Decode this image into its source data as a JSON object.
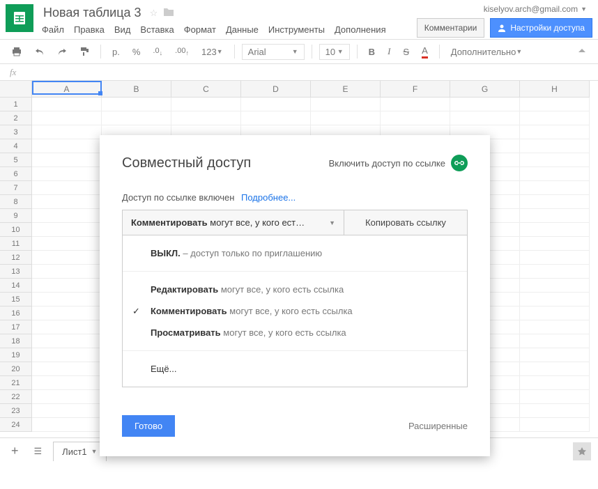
{
  "header": {
    "doc_title": "Новая таблица 3",
    "user_email": "kiselyov.arch@gmail.com",
    "comments_btn": "Комментарии",
    "share_btn": "Настройки доступа"
  },
  "menu": {
    "file": "Файл",
    "edit": "Правка",
    "view": "Вид",
    "insert": "Вставка",
    "format": "Формат",
    "data": "Данные",
    "tools": "Инструменты",
    "addons": "Дополнения"
  },
  "toolbar": {
    "currency": "р.",
    "percent": "%",
    "dec_dec": ".0",
    "dec_inc": ".00",
    "numfmt": "123",
    "font": "Arial",
    "size": "10",
    "bold": "B",
    "italic": "I",
    "strike": "S",
    "textcolor": "A",
    "more": "Дополнительно"
  },
  "fx_label": "fx",
  "columns": [
    "A",
    "B",
    "C",
    "D",
    "E",
    "F",
    "G",
    "H"
  ],
  "rows": [
    1,
    2,
    3,
    4,
    5,
    6,
    7,
    8,
    9,
    10,
    11,
    12,
    13,
    14,
    15,
    16,
    17,
    18,
    19,
    20,
    21,
    22,
    23,
    24
  ],
  "footer": {
    "sheet_tab": "Лист1"
  },
  "share": {
    "title": "Совместный доступ",
    "enable_link_label": "Включить доступ по ссылке",
    "link_status": "Доступ по ссылке включен",
    "learn_more": "Подробнее...",
    "select_bold": "Комментировать",
    "select_rest": " могут все, у кого есть с...",
    "copy_link": "Копировать ссылку",
    "opt_off_bold": "ВЫКЛ.",
    "opt_off_rest": " – доступ только по приглашению",
    "opt_edit_bold": "Редактировать",
    "opt_comment_bold": "Комментировать",
    "opt_view_bold": "Просматривать",
    "opt_suffix": " могут все, у кого есть ссылка",
    "more": "Ещё...",
    "done": "Готово",
    "advanced": "Расширенные"
  }
}
